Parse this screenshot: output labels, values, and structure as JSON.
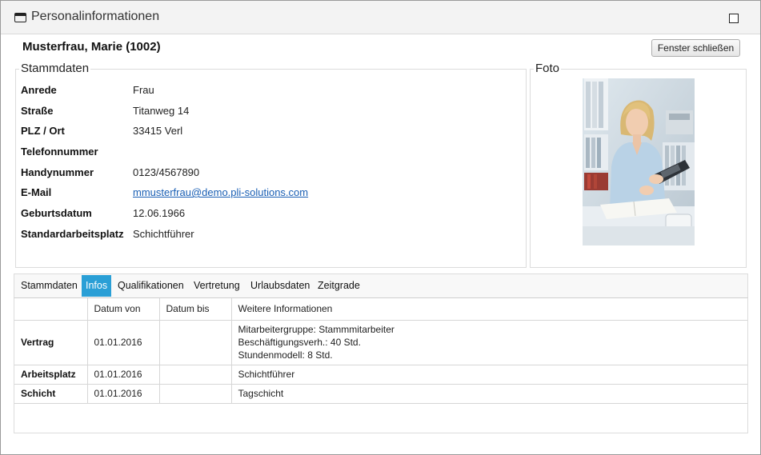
{
  "window": {
    "title": "Personalinformationen"
  },
  "header": {
    "person_name": "Musterfrau, Marie (1002)",
    "close_button_label": "Fenster schließen"
  },
  "stammdaten": {
    "legend": "Stammdaten",
    "fields": [
      {
        "label": "Anrede",
        "value": "Frau"
      },
      {
        "label": "Straße",
        "value": "Titanweg 14"
      },
      {
        "label": "PLZ / Ort",
        "value": "33415 Verl"
      },
      {
        "label": "Telefonnummer",
        "value": ""
      },
      {
        "label": "Handynummer",
        "value": "0123/4567890"
      },
      {
        "label": "E-Mail",
        "value": "mmusterfrau@demo.pli-solutions.com"
      },
      {
        "label": "Geburtsdatum",
        "value": "12.06.1966"
      },
      {
        "label": "Standardarbeitsplatz",
        "value": "Schichtführer"
      }
    ]
  },
  "foto": {
    "legend": "Foto"
  },
  "tabs": [
    {
      "label": "Stammdaten",
      "active": false
    },
    {
      "label": "Infos",
      "active": true
    },
    {
      "label": "Qualifikationen",
      "active": false
    },
    {
      "label": "Vertretung",
      "active": false
    },
    {
      "label": "Urlaubsdaten",
      "active": false
    },
    {
      "label": "Zeitgrade",
      "active": false
    }
  ],
  "info_table": {
    "columns": [
      "",
      "Datum von",
      "Datum bis",
      "Weitere Informationen"
    ],
    "rows": [
      {
        "label": "Vertrag",
        "datum_von": "01.01.2016",
        "datum_bis": "",
        "info": [
          "Mitarbeitergruppe: Stammmitarbeiter",
          "Beschäftigungsverh.: 40 Std.",
          "Stundenmodell: 8 Std."
        ]
      },
      {
        "label": "Arbeitsplatz",
        "datum_von": "01.01.2016",
        "datum_bis": "",
        "info": [
          "Schichtführer"
        ]
      },
      {
        "label": "Schicht",
        "datum_von": "01.01.2016",
        "datum_bis": "",
        "info": [
          "Tagschicht"
        ]
      }
    ]
  },
  "colors": {
    "active_tab": "#2a9fd6",
    "link": "#1a5fb4"
  }
}
